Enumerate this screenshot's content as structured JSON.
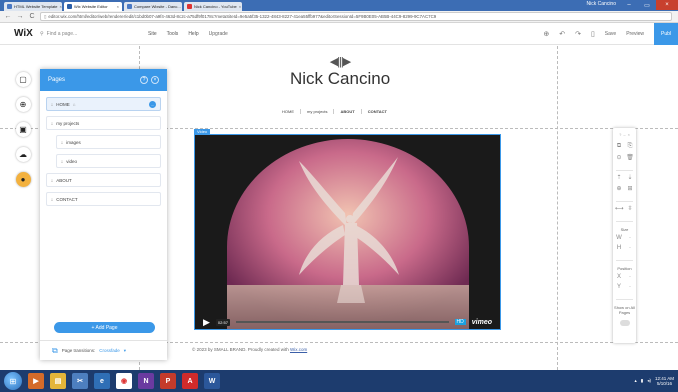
{
  "browser": {
    "tabs": [
      {
        "label": "HTML Website Template",
        "icon": "page-icon"
      },
      {
        "label": "Wix Website Editor",
        "icon": "wix-icon",
        "active": true
      },
      {
        "label": "Compare Wixsite - Danc...",
        "icon": "page-icon"
      },
      {
        "label": "Nick Cancino - YouTube",
        "icon": "youtube-icon"
      }
    ],
    "user_badge": "Nick Cancino",
    "url": "editor.wix.com/html/editor/web/renderer/edit/c1bd0b07-a9f4-463d-8c2c-a75df9f0178c?metaSiteId=9e5a5f35-1322-4843-8227-41ea55ffb977&editorSessionId=5F9B0E05-AB5B-44C9-8299-9C7AC7C9"
  },
  "wix": {
    "logo": "WiX",
    "page_search_placeholder": "Find a page...",
    "menu": [
      "Site",
      "Tools",
      "Help",
      "Upgrade"
    ],
    "actions": {
      "save": "Save",
      "preview": "Preview",
      "publish": "Publ"
    }
  },
  "site": {
    "logo_glyph": "◀|||▶",
    "name": "Nick Cancino",
    "nav": [
      "HOME",
      "my projects",
      "ABOUT",
      "CONTACT"
    ],
    "video_tag": "Video",
    "video_time": "02:57",
    "video_hd": "HD",
    "video_brand": "vimeo",
    "footer_prefix": "© 2023 by SMALL BRAND. Proudly created with ",
    "footer_link": "Wix.com"
  },
  "pages_panel": {
    "title": "Pages",
    "pages": [
      {
        "label": "HOME",
        "selected": true,
        "indent": false,
        "home": true
      },
      {
        "label": "my projects",
        "selected": false,
        "indent": false
      },
      {
        "label": "images",
        "selected": false,
        "indent": true
      },
      {
        "label": "video",
        "selected": false,
        "indent": true
      },
      {
        "label": "ABOUT",
        "selected": false,
        "indent": false
      },
      {
        "label": "CONTACT",
        "selected": false,
        "indent": false
      }
    ],
    "add_page": "+ Add Page",
    "transitions_label": "Page transitions:",
    "transitions_value": "Crossfade"
  },
  "right_toolbar": {
    "size_label": "Size",
    "size_w": "W",
    "size_h": "H",
    "position_label": "Position",
    "pos_x": "X",
    "pos_y": "Y",
    "show_all_label": "Show on All Pages"
  },
  "taskbar": {
    "time": "12:41 AM",
    "date": "5/10/16"
  }
}
